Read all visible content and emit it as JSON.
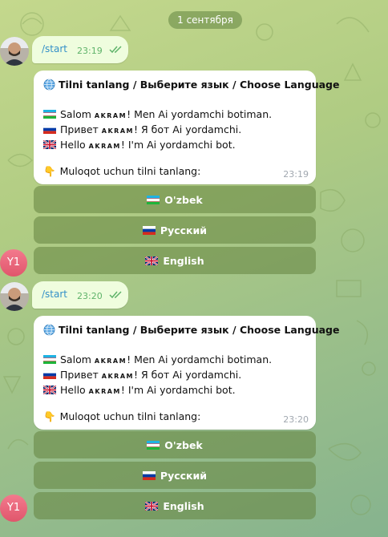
{
  "date_label": "1 сентября",
  "colors": {
    "wallpaper": "#b0cc83",
    "out_bubble": "#effdde",
    "link": "#3390c8",
    "bot_avatar": "#e85e73"
  },
  "messages": [
    {
      "outgoing": {
        "text": "/start",
        "time": "23:19"
      },
      "bot": {
        "title": "Tilni tanlang / Выберите язык / Choose Language",
        "greet_uz_a": "Salom ",
        "greet_uz_b": "! Men Ai yordamchi botiman.",
        "greet_ru_a": "Привет ",
        "greet_ru_b": "! Я бот Ai yordamchi.",
        "greet_en_a": "Hello ",
        "greet_en_b": "! I'm Ai yordamchi bot.",
        "username": "AKRAM",
        "prompt": "Muloqot uchun tilni tanlang:",
        "time": "23:19"
      },
      "buttons": [
        "O'zbek",
        "Русский",
        "English"
      ],
      "bot_avatar": "Y1"
    },
    {
      "outgoing": {
        "text": "/start",
        "time": "23:20"
      },
      "bot": {
        "title": "Tilni tanlang / Выберите язык / Choose Language",
        "greet_uz_a": "Salom ",
        "greet_uz_b": "! Men Ai yordamchi botiman.",
        "greet_ru_a": "Привет ",
        "greet_ru_b": "! Я бот Ai yordamchi.",
        "greet_en_a": "Hello ",
        "greet_en_b": "! I'm Ai yordamchi bot.",
        "username": "AKRAM",
        "prompt": "Muloqot uchun tilni tanlang:",
        "time": "23:20"
      },
      "buttons": [
        "O'zbek",
        "Русский",
        "English"
      ],
      "bot_avatar": "Y1"
    }
  ]
}
